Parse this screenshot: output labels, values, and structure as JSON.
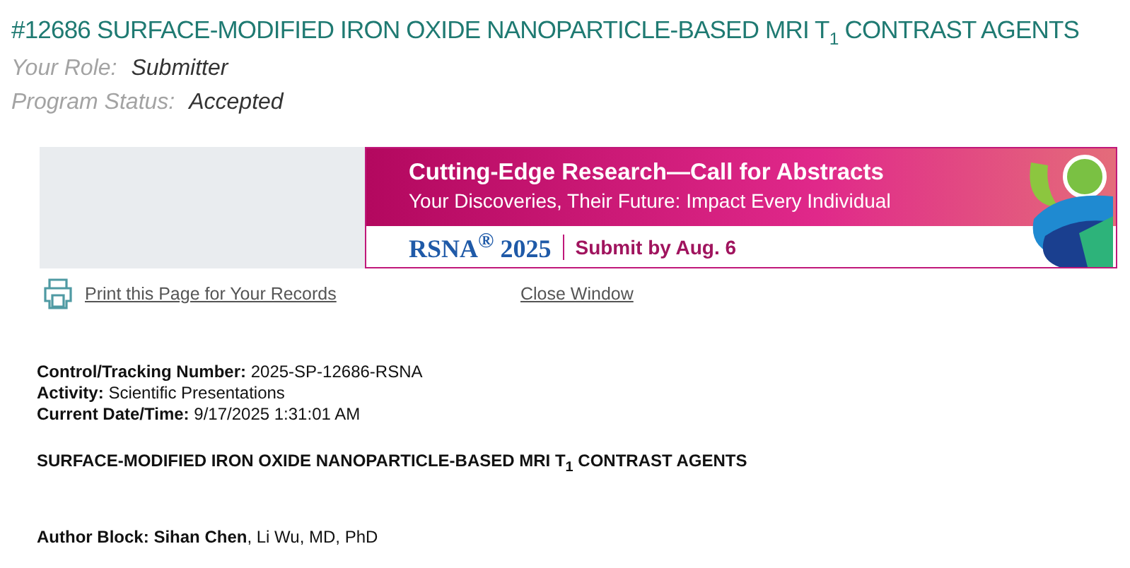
{
  "header": {
    "title": "#12686 SURFACE-MODIFIED IRON OXIDE NANOPARTICLE-BASED MRI T$_{1}$ CONTRAST AGENTS",
    "fields": [
      {
        "label": "Your Role:",
        "value": "Submitter"
      },
      {
        "label": "Program Status:",
        "value": "Accepted"
      }
    ]
  },
  "banner": {
    "headline": "Cutting-Edge Research—Call for Abstracts",
    "tagline": "Your Discoveries, Their Future: Impact Every Individual",
    "logo": "RSNA$^{®}$ 2025",
    "cta": "Submit by Aug. 6"
  },
  "links": [
    {
      "label": "Print this Page for Your Records",
      "kind": "print"
    },
    {
      "label": "Close Window",
      "kind": "plain"
    }
  ],
  "details": [
    {
      "label": "Control/Tracking Number:",
      "value": "2025-SP-12686-RSNA"
    },
    {
      "label": "Activity:",
      "value": "Scientific Presentations"
    },
    {
      "label": "Current Date/Time:",
      "value": "9/17/2025 1:31:01 AM"
    }
  ],
  "abstract_title": "SURFACE-MODIFIED IRON OXIDE NANOPARTICLE-BASED MRI T$_{1}$ CONTRAST AGENTS",
  "author_block": {
    "label": "Author Block:",
    "authors": "**Sihan Chen**, Li Wu, MD, PhD"
  }
}
